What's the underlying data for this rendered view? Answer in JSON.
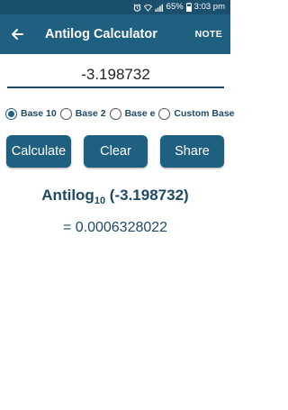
{
  "status_bar": {
    "battery": "65%",
    "time": "3:03 pm"
  },
  "app_bar": {
    "title": "Antilog Calculator",
    "note_label": "NOTE",
    "back_icon": "arrow-left-icon"
  },
  "input": {
    "value": "-3.198732"
  },
  "bases": [
    {
      "label": "Base 10",
      "selected": true
    },
    {
      "label": "Base 2",
      "selected": false
    },
    {
      "label": "Base e",
      "selected": false
    },
    {
      "label": "Custom Base",
      "selected": false
    }
  ],
  "buttons": {
    "calculate": "Calculate",
    "clear": "Clear",
    "share": "Share"
  },
  "result": {
    "prefix": "Antilog",
    "base": "10",
    "argument": " (-3.198732)",
    "value": "= 0.0006328022"
  },
  "colors": {
    "primary": "#1f5f80",
    "status_bar": "#1a4f6e",
    "text_accent": "#1e4a66"
  }
}
